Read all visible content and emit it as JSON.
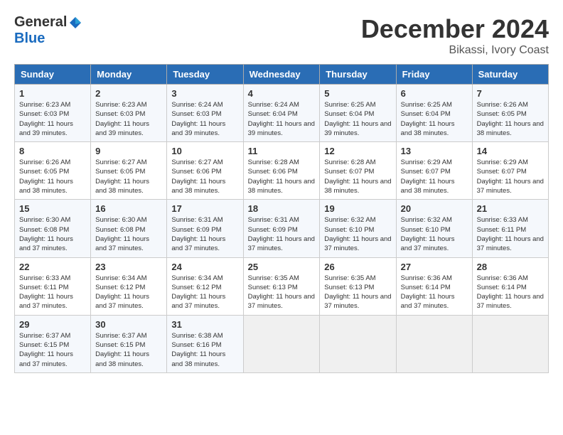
{
  "header": {
    "logo_general": "General",
    "logo_blue": "Blue",
    "month_title": "December 2024",
    "location": "Bikassi, Ivory Coast"
  },
  "weekdays": [
    "Sunday",
    "Monday",
    "Tuesday",
    "Wednesday",
    "Thursday",
    "Friday",
    "Saturday"
  ],
  "weeks": [
    [
      {
        "day": "1",
        "sunrise": "6:23 AM",
        "sunset": "6:03 PM",
        "daylight": "11 hours and 39 minutes."
      },
      {
        "day": "2",
        "sunrise": "6:23 AM",
        "sunset": "6:03 PM",
        "daylight": "11 hours and 39 minutes."
      },
      {
        "day": "3",
        "sunrise": "6:24 AM",
        "sunset": "6:03 PM",
        "daylight": "11 hours and 39 minutes."
      },
      {
        "day": "4",
        "sunrise": "6:24 AM",
        "sunset": "6:04 PM",
        "daylight": "11 hours and 39 minutes."
      },
      {
        "day": "5",
        "sunrise": "6:25 AM",
        "sunset": "6:04 PM",
        "daylight": "11 hours and 39 minutes."
      },
      {
        "day": "6",
        "sunrise": "6:25 AM",
        "sunset": "6:04 PM",
        "daylight": "11 hours and 38 minutes."
      },
      {
        "day": "7",
        "sunrise": "6:26 AM",
        "sunset": "6:05 PM",
        "daylight": "11 hours and 38 minutes."
      }
    ],
    [
      {
        "day": "8",
        "sunrise": "6:26 AM",
        "sunset": "6:05 PM",
        "daylight": "11 hours and 38 minutes."
      },
      {
        "day": "9",
        "sunrise": "6:27 AM",
        "sunset": "6:05 PM",
        "daylight": "11 hours and 38 minutes."
      },
      {
        "day": "10",
        "sunrise": "6:27 AM",
        "sunset": "6:06 PM",
        "daylight": "11 hours and 38 minutes."
      },
      {
        "day": "11",
        "sunrise": "6:28 AM",
        "sunset": "6:06 PM",
        "daylight": "11 hours and 38 minutes."
      },
      {
        "day": "12",
        "sunrise": "6:28 AM",
        "sunset": "6:07 PM",
        "daylight": "11 hours and 38 minutes."
      },
      {
        "day": "13",
        "sunrise": "6:29 AM",
        "sunset": "6:07 PM",
        "daylight": "11 hours and 38 minutes."
      },
      {
        "day": "14",
        "sunrise": "6:29 AM",
        "sunset": "6:07 PM",
        "daylight": "11 hours and 37 minutes."
      }
    ],
    [
      {
        "day": "15",
        "sunrise": "6:30 AM",
        "sunset": "6:08 PM",
        "daylight": "11 hours and 37 minutes."
      },
      {
        "day": "16",
        "sunrise": "6:30 AM",
        "sunset": "6:08 PM",
        "daylight": "11 hours and 37 minutes."
      },
      {
        "day": "17",
        "sunrise": "6:31 AM",
        "sunset": "6:09 PM",
        "daylight": "11 hours and 37 minutes."
      },
      {
        "day": "18",
        "sunrise": "6:31 AM",
        "sunset": "6:09 PM",
        "daylight": "11 hours and 37 minutes."
      },
      {
        "day": "19",
        "sunrise": "6:32 AM",
        "sunset": "6:10 PM",
        "daylight": "11 hours and 37 minutes."
      },
      {
        "day": "20",
        "sunrise": "6:32 AM",
        "sunset": "6:10 PM",
        "daylight": "11 hours and 37 minutes."
      },
      {
        "day": "21",
        "sunrise": "6:33 AM",
        "sunset": "6:11 PM",
        "daylight": "11 hours and 37 minutes."
      }
    ],
    [
      {
        "day": "22",
        "sunrise": "6:33 AM",
        "sunset": "6:11 PM",
        "daylight": "11 hours and 37 minutes."
      },
      {
        "day": "23",
        "sunrise": "6:34 AM",
        "sunset": "6:12 PM",
        "daylight": "11 hours and 37 minutes."
      },
      {
        "day": "24",
        "sunrise": "6:34 AM",
        "sunset": "6:12 PM",
        "daylight": "11 hours and 37 minutes."
      },
      {
        "day": "25",
        "sunrise": "6:35 AM",
        "sunset": "6:13 PM",
        "daylight": "11 hours and 37 minutes."
      },
      {
        "day": "26",
        "sunrise": "6:35 AM",
        "sunset": "6:13 PM",
        "daylight": "11 hours and 37 minutes."
      },
      {
        "day": "27",
        "sunrise": "6:36 AM",
        "sunset": "6:14 PM",
        "daylight": "11 hours and 37 minutes."
      },
      {
        "day": "28",
        "sunrise": "6:36 AM",
        "sunset": "6:14 PM",
        "daylight": "11 hours and 37 minutes."
      }
    ],
    [
      {
        "day": "29",
        "sunrise": "6:37 AM",
        "sunset": "6:15 PM",
        "daylight": "11 hours and 37 minutes."
      },
      {
        "day": "30",
        "sunrise": "6:37 AM",
        "sunset": "6:15 PM",
        "daylight": "11 hours and 38 minutes."
      },
      {
        "day": "31",
        "sunrise": "6:38 AM",
        "sunset": "6:16 PM",
        "daylight": "11 hours and 38 minutes."
      },
      null,
      null,
      null,
      null
    ]
  ],
  "labels": {
    "sunrise": "Sunrise:",
    "sunset": "Sunset:",
    "daylight": "Daylight:"
  }
}
